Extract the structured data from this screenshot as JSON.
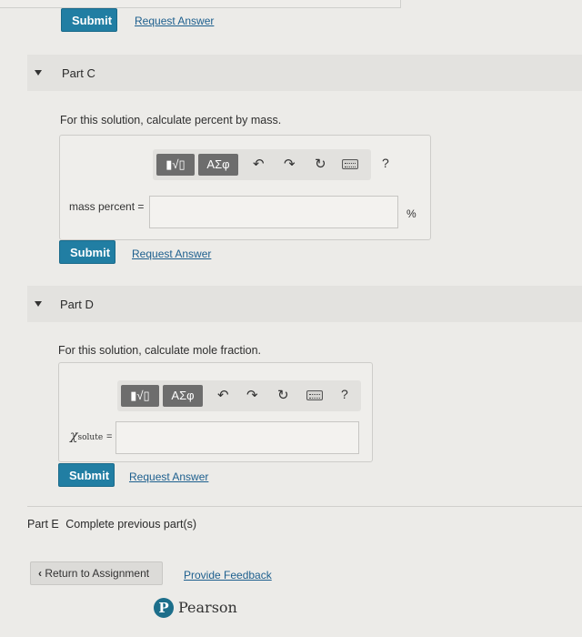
{
  "common": {
    "submit_label": "Submit",
    "request_label": "Request Answer"
  },
  "toolbar": {
    "templates_label": "▮√▯",
    "greek_label": "ΑΣφ",
    "help_label": "?"
  },
  "part_c": {
    "title": "Part C",
    "instruction": "For this solution, calculate percent by mass.",
    "field_label": "mass percent =",
    "field_value": "",
    "unit": "%"
  },
  "part_d": {
    "title": "Part D",
    "instruction": "For this solution, calculate mole fraction.",
    "field_label_var": "χ",
    "field_label_sub": "solute",
    "field_label_eq": "=",
    "field_value": ""
  },
  "part_e": {
    "title": "Part E",
    "status": "Complete previous part(s)"
  },
  "footer": {
    "return_label": "Return to Assignment",
    "feedback_label": "Provide Feedback",
    "logo_letter": "P",
    "brand": "Pearson"
  }
}
